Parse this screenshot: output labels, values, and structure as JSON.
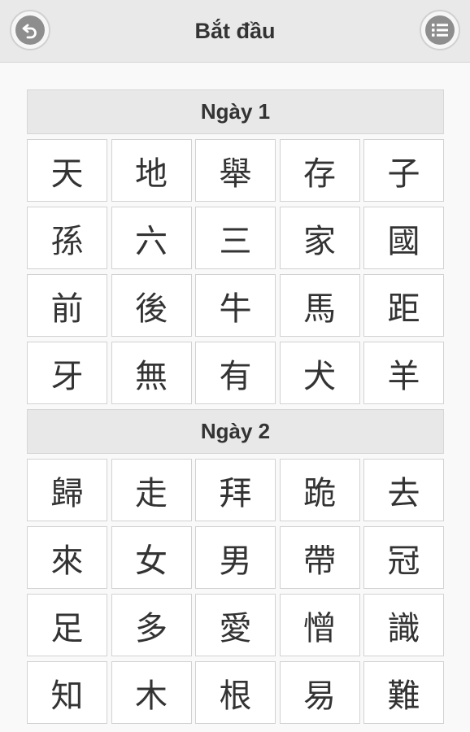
{
  "header": {
    "title": "Bắt đầu",
    "back_icon": "back-arrow-icon",
    "menu_icon": "list-icon"
  },
  "days": [
    {
      "label": "Ngày 1",
      "characters": [
        "天",
        "地",
        "舉",
        "存",
        "子",
        "孫",
        "六",
        "三",
        "家",
        "國",
        "前",
        "後",
        "牛",
        "馬",
        "距",
        "牙",
        "無",
        "有",
        "犬",
        "羊"
      ]
    },
    {
      "label": "Ngày 2",
      "characters": [
        "歸",
        "走",
        "拜",
        "跪",
        "去",
        "來",
        "女",
        "男",
        "帶",
        "冠",
        "足",
        "多",
        "愛",
        "憎",
        "識",
        "知",
        "木",
        "根",
        "易",
        "難"
      ]
    }
  ]
}
